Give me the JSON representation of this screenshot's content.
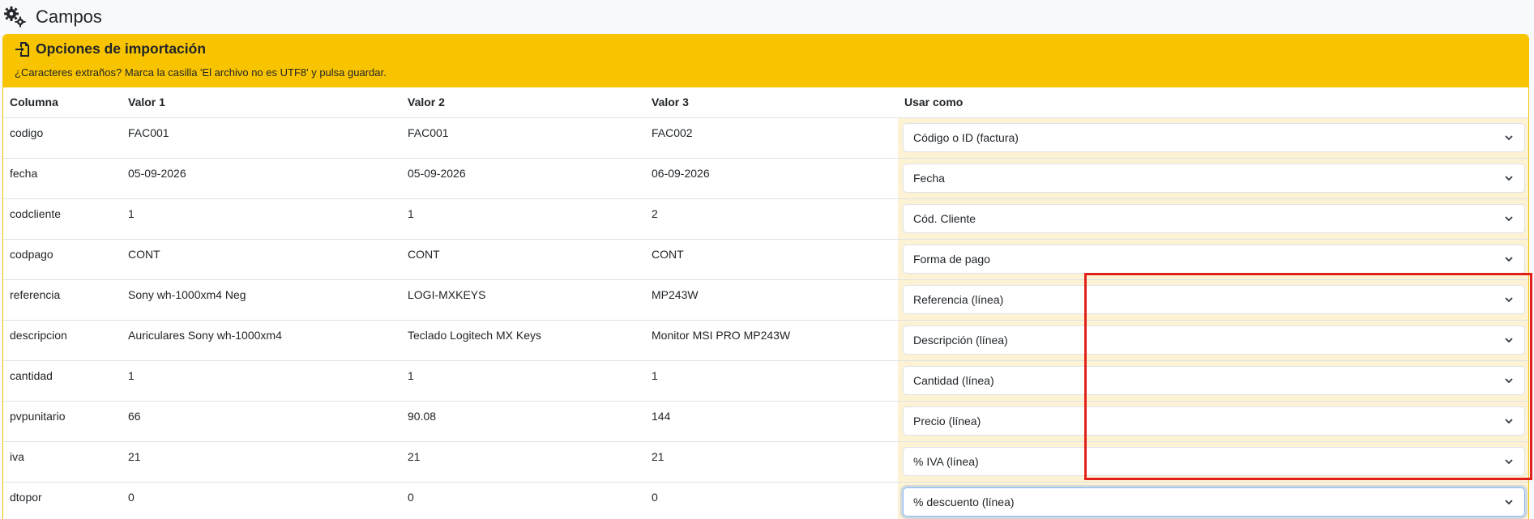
{
  "header": {
    "title": "Campos",
    "icon": "gears-icon"
  },
  "import_options": {
    "title": "Opciones de importación",
    "icon": "file-import-icon",
    "subtitle": "¿Caracteres extraños? Marca la casilla 'El archivo no es UTF8' y pulsa guardar.",
    "accent_color": "#f8c400"
  },
  "table": {
    "headers": {
      "columna": "Columna",
      "valor1": "Valor 1",
      "valor2": "Valor 2",
      "valor3": "Valor 3",
      "usar": "Usar como"
    },
    "rows": [
      {
        "columna": "codigo",
        "v1": "FAC001",
        "v2": "FAC001",
        "v3": "FAC002",
        "usar": "Código o ID (factura)"
      },
      {
        "columna": "fecha",
        "v1": "05-09-2026",
        "v2": "05-09-2026",
        "v3": "06-09-2026",
        "usar": "Fecha"
      },
      {
        "columna": "codcliente",
        "v1": "1",
        "v2": "1",
        "v3": "2",
        "usar": "Cód. Cliente"
      },
      {
        "columna": "codpago",
        "v1": "CONT",
        "v2": "CONT",
        "v3": "CONT",
        "usar": "Forma de pago"
      },
      {
        "columna": "referencia",
        "v1": "Sony wh-1000xm4 Neg",
        "v2": "LOGI-MXKEYS",
        "v3": "MP243W",
        "usar": "Referencia (línea)"
      },
      {
        "columna": "descripcion",
        "v1": "Auriculares Sony wh-1000xm4",
        "v2": "Teclado Logitech MX Keys",
        "v3": "Monitor MSI PRO MP243W",
        "usar": "Descripción (línea)"
      },
      {
        "columna": "cantidad",
        "v1": "1",
        "v2": "1",
        "v3": "1",
        "usar": "Cantidad (línea)"
      },
      {
        "columna": "pvpunitario",
        "v1": "66",
        "v2": "90.08",
        "v3": "144",
        "usar": "Precio (línea)"
      },
      {
        "columna": "iva",
        "v1": "21",
        "v2": "21",
        "v3": "21",
        "usar": "% IVA (línea)"
      },
      {
        "columna": "dtopor",
        "v1": "0",
        "v2": "0",
        "v3": "0",
        "usar": "% descuento (línea)"
      }
    ]
  },
  "highlight_color": "#e0211b"
}
